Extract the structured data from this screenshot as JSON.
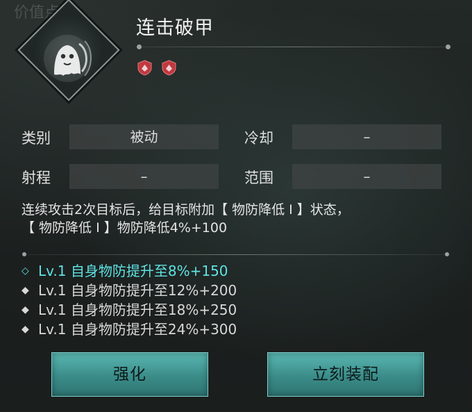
{
  "background_hint": "价值点",
  "skill": {
    "name": "连击破甲",
    "icon": "ghost-spirit-icon",
    "badges": [
      "red-shield-badge-icon",
      "red-shield-badge-icon"
    ]
  },
  "attributes": {
    "category_label": "类别",
    "category_value": "被动",
    "cooldown_label": "冷却",
    "cooldown_value": "–",
    "range_label": "射程",
    "range_value": "–",
    "area_label": "范围",
    "area_value": "–"
  },
  "description": {
    "line1": "连续攻击2次目标后，给目标附加【 物防降低 I 】状态，",
    "line2": "【 物防降低 I 】物防降低4%+100"
  },
  "levels": [
    {
      "text": "Lv.1 自身物防提升至8%+150",
      "active": true
    },
    {
      "text": "Lv.1 自身物防提升至12%+200",
      "active": false
    },
    {
      "text": "Lv.1 自身物防提升至18%+250",
      "active": false
    },
    {
      "text": "Lv.1 自身物防提升至24%+300",
      "active": false
    }
  ],
  "buttons": {
    "enhance": "强化",
    "equip_now": "立刻装配"
  },
  "colors": {
    "accent": "#5fe3e3",
    "button": "#3b8c89",
    "badge": "#c0393f"
  }
}
